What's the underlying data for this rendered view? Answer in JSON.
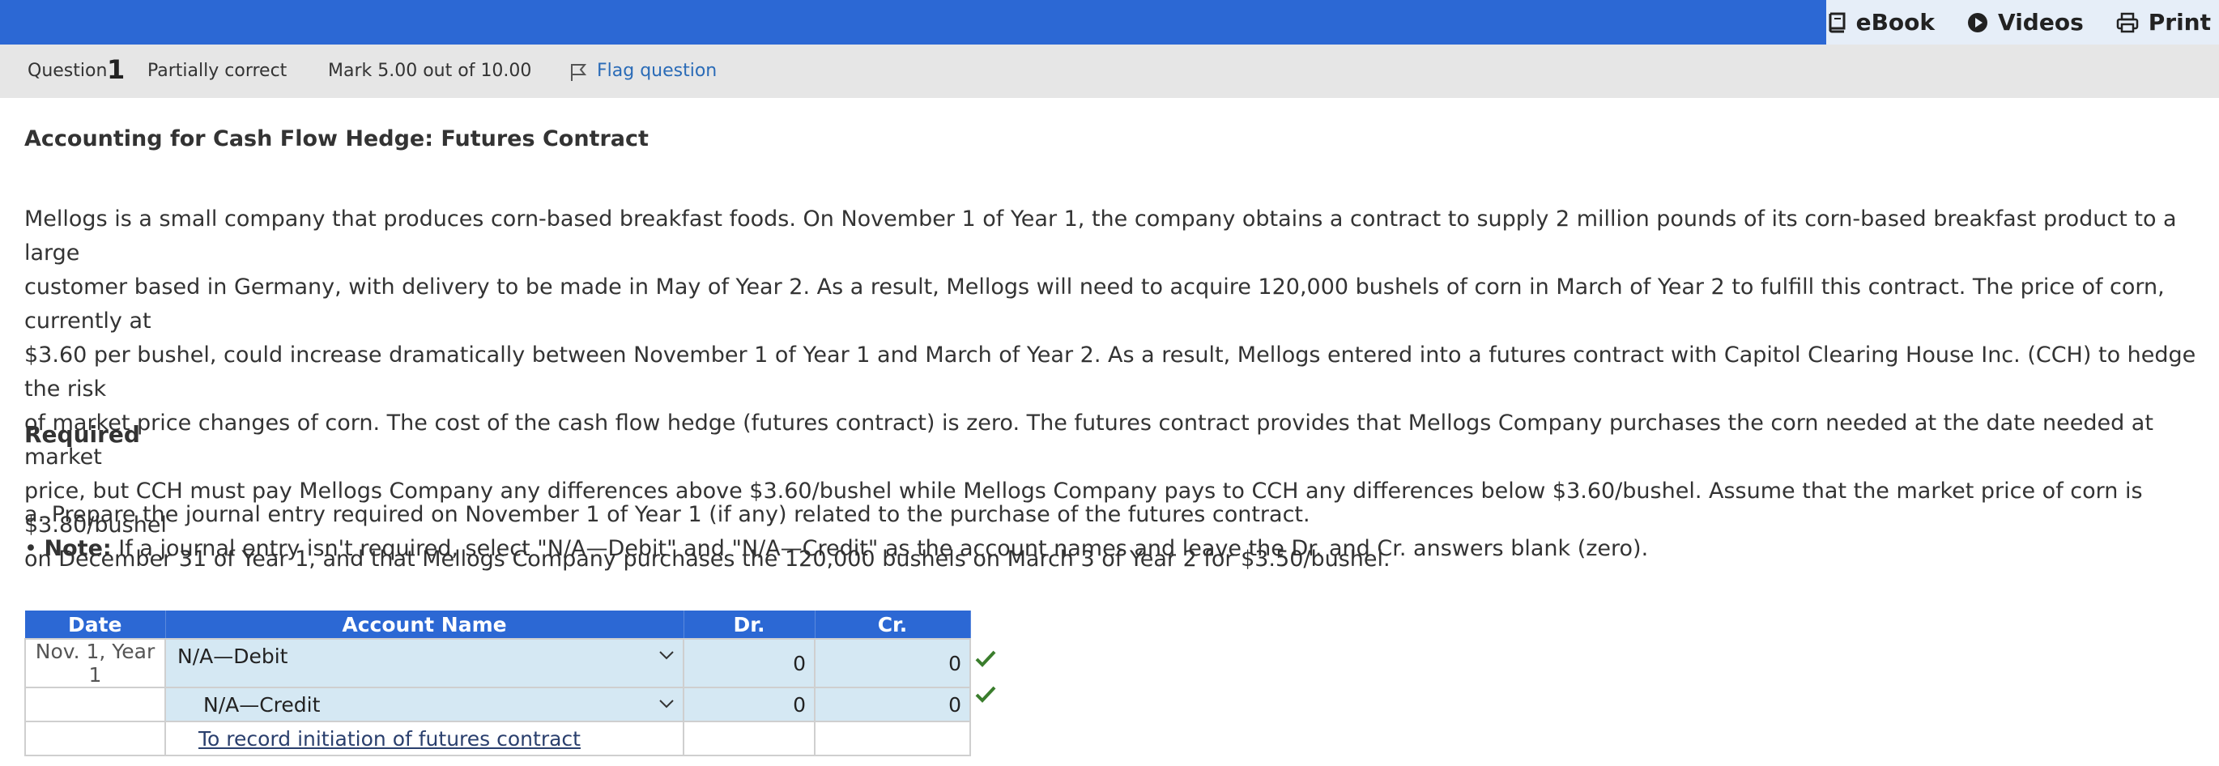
{
  "toolbar": {
    "ebook_label": "eBook",
    "videos_label": "Videos",
    "print_label": "Print"
  },
  "question_bar": {
    "question_word": "Question",
    "question_number": "1",
    "status": "Partially correct",
    "mark": "Mark 5.00 out of 10.00",
    "flag_label": "Flag question"
  },
  "question": {
    "title": "Accounting for Cash Flow Hedge: Futures Contract",
    "body": "Mellogs is a small company that produces corn-based breakfast foods. On November 1 of Year 1, the company obtains a contract to supply 2 million pounds of its corn-based breakfast product to a large\ncustomer based in Germany, with delivery to be made in May of Year 2. As a result, Mellogs will need to acquire 120,000 bushels of corn in March of Year 2 to fulfill this contract. The price of corn, currently at\n$3.60 per bushel, could increase dramatically between November 1 of Year 1 and March of Year 2. As a result, Mellogs entered into a futures contract with Capitol Clearing House Inc. (CCH) to hedge the risk\nof market price changes of corn. The cost of the cash flow hedge (futures contract) is zero. The futures contract provides that Mellogs Company purchases the corn needed at the date needed at market\nprice, but CCH must pay Mellogs Company any differences above $3.60/bushel while Mellogs Company pays to CCH any differences below $3.60/bushel. Assume that the market price of corn is $3.80/bushel\non December 31 of Year 1, and that Mellogs Company purchases the 120,000 bushels on March 3 of Year 2 for $3.50/bushel.",
    "required_label": "Required",
    "task_line": "a. Prepare the journal entry required on November 1 of Year 1 (if any) related to the purchase of the futures contract.",
    "note_bullet": "•",
    "note_label": "Note:",
    "note_text": " If a journal entry isn't required, select \"N/A—Debit\" and \"N/A—Credit\" as the account names and leave the Dr. and Cr. answers blank (zero)."
  },
  "journal": {
    "headers": [
      "Date",
      "Account Name",
      "Dr.",
      "Cr."
    ],
    "rows": [
      {
        "date": "Nov. 1, Year 1",
        "account": "N/A—Debit",
        "dr": "0",
        "cr": "0",
        "correct": true
      },
      {
        "date": "",
        "account": "N/A—Credit",
        "dr": "0",
        "cr": "0",
        "correct": true
      }
    ],
    "memo": "To record initiation of futures contract"
  },
  "colors": {
    "brand_blue": "#2c68d4",
    "input_bg": "#d5e8f3",
    "check_green": "#3a7d2c",
    "link_blue": "#2a6bb7"
  },
  "icons": [
    "book-icon",
    "play-circle-icon",
    "printer-icon",
    "flag-icon",
    "chevron-down-icon",
    "check-icon"
  ]
}
